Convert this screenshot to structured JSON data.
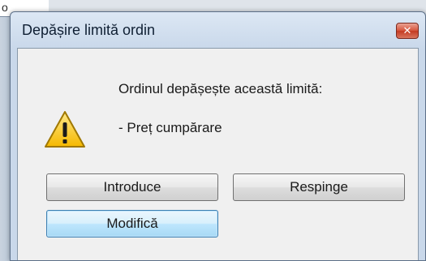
{
  "background": {
    "fragment_text": "o"
  },
  "dialog": {
    "title": "Depășire limită ordin",
    "close_icon": "close-icon",
    "message": "Ordinul depășește această limită:",
    "detail": "- Preț cumpărare",
    "icon": "warning-icon",
    "buttons": {
      "introduce": "Introduce",
      "respinge": "Respinge",
      "modifica": "Modifică"
    },
    "colors": {
      "close_button": "#d6573f",
      "warning_yellow": "#f5c400",
      "default_button_border": "#3c7fb1"
    }
  }
}
